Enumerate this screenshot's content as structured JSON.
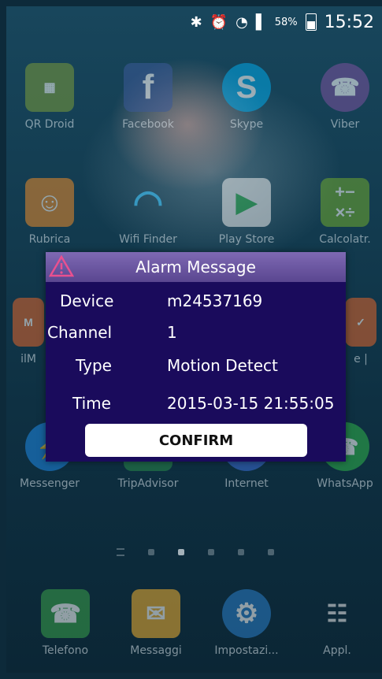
{
  "status": {
    "battery": "58%",
    "time": "15:52"
  },
  "apps": {
    "row1": [
      {
        "label": "QR Droid",
        "icon": "qr-droid-icon"
      },
      {
        "label": "Facebook",
        "icon": "facebook-icon"
      },
      {
        "label": "Skype",
        "icon": "skype-icon"
      },
      {
        "label": "Viber",
        "icon": "viber-icon"
      }
    ],
    "row2": [
      {
        "label": "Rubrica",
        "icon": "contacts-icon"
      },
      {
        "label": "Wifi Finder",
        "icon": "wifi-icon"
      },
      {
        "label": "Play Store",
        "icon": "play-store-icon"
      },
      {
        "label": "Calcolatr.",
        "icon": "calculator-icon"
      }
    ],
    "row3_partial": [
      {
        "label": "ilM",
        "icon": "ilmeteo-icon"
      },
      {
        "label": "e |",
        "icon": "app-icon"
      }
    ],
    "row4": [
      {
        "label": "Messenger",
        "icon": "messenger-icon"
      },
      {
        "label": "TripAdvisor",
        "icon": "tripadvisor-icon"
      },
      {
        "label": "Internet",
        "icon": "internet-icon"
      },
      {
        "label": "WhatsApp",
        "icon": "whatsapp-icon"
      }
    ],
    "dock": [
      {
        "label": "Telefono",
        "icon": "phone-icon"
      },
      {
        "label": "Messaggi",
        "icon": "messages-icon"
      },
      {
        "label": "Impostazi...",
        "icon": "settings-icon"
      },
      {
        "label": "Appl.",
        "icon": "apps-grid-icon"
      }
    ]
  },
  "dialog": {
    "title": "Alarm Message",
    "rows": [
      {
        "label": "Device",
        "value": "m24537169"
      },
      {
        "label": "Channel",
        "value": "1"
      },
      {
        "label": "Type",
        "value": "Motion Detect"
      },
      {
        "label": "Time",
        "value": "2015-03-15 21:55:05"
      }
    ],
    "confirm_label": "CONFIRM"
  },
  "colors": {
    "dialog_bg": "#1a0b5c",
    "dialog_header": "#6b57a3",
    "warning": "#e9508f"
  }
}
